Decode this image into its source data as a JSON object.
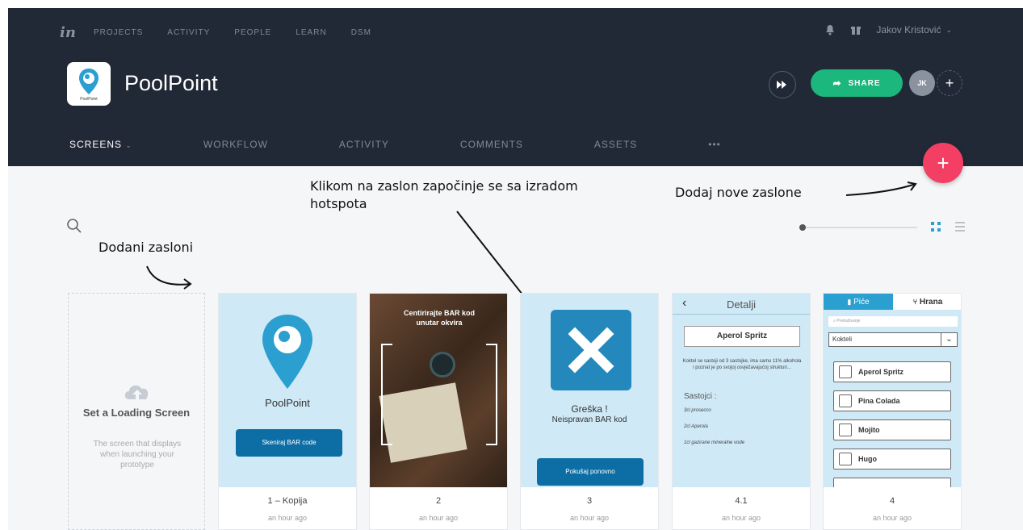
{
  "topnav": {
    "logo": "in",
    "items": [
      "PROJECTS",
      "ACTIVITY",
      "PEOPLE",
      "LEARN",
      "DSM"
    ],
    "user": "Jakov Kristović"
  },
  "project": {
    "title": "PoolPoint",
    "icon_label": "PoolPoint",
    "share_label": "SHARE",
    "avatar_initials": "JK"
  },
  "tabs": [
    "SCREENS",
    "WORKFLOW",
    "ACTIVITY",
    "COMMENTS",
    "ASSETS",
    "•••"
  ],
  "notes": {
    "added": "Dodani zasloni",
    "click": "Klikom na zaslon započinje se sa izradom hotspota",
    "add_new": "Dodaj nove zaslone"
  },
  "loading_card": {
    "title": "Set a Loading Screen",
    "desc": "The screen that displays when launching your prototype"
  },
  "cards": [
    {
      "name": "1 – Kopija",
      "time": "an hour ago",
      "app_title": "PoolPoint",
      "button": "Skeniraj BAR code"
    },
    {
      "name": "2",
      "time": "an hour ago",
      "overlay": "Centirirajte BAR kod unutar okvira"
    },
    {
      "name": "3",
      "time": "an hour ago",
      "err_title": "Greška !",
      "err_sub": "Neispravan BAR kod",
      "button": "Pokušaj ponovno"
    },
    {
      "name": "4.1",
      "time": "an hour ago",
      "header": "Detalji",
      "box": "Aperol Spritz",
      "text": "Koktel se sastoji od 3 sastojke, ima samo 11% alkohola i poznat je po svojoj osvježavajućoj strukturi...",
      "ing_title": "Sastojci :",
      "ing": [
        "3cl prosecco",
        "2cl Aperola",
        "1cl gazirane mineralne vode"
      ]
    },
    {
      "name": "4",
      "time": "an hour ago",
      "tab1": "Piće",
      "tab2": "Hrana",
      "search": "Pretraživanje",
      "select": "Kokteli",
      "items": [
        "Aperol Spritz",
        "Pina Colada",
        "Mojito",
        "Hugo"
      ]
    }
  ]
}
